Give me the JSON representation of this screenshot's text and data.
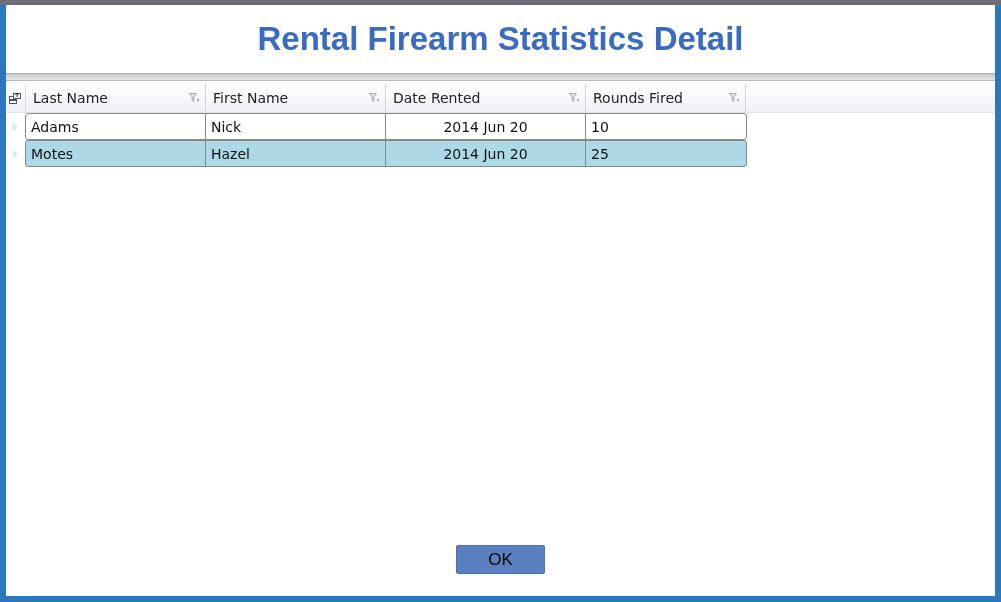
{
  "dialog": {
    "title": "Rental Firearm Statistics Detail"
  },
  "table": {
    "columns": [
      {
        "label": "Last Name",
        "kind": "text"
      },
      {
        "label": "First Name",
        "kind": "text"
      },
      {
        "label": "Date Rented",
        "kind": "date"
      },
      {
        "label": "Rounds Fired",
        "kind": "number"
      }
    ],
    "rows": [
      {
        "cells": [
          "Adams",
          "Nick",
          "2014 Jun 20",
          "10"
        ],
        "selected": false
      },
      {
        "cells": [
          "Motes",
          "Hazel",
          "2014 Jun 20",
          "25"
        ],
        "selected": true
      }
    ]
  },
  "buttons": [
    {
      "label": "OK"
    }
  ]
}
